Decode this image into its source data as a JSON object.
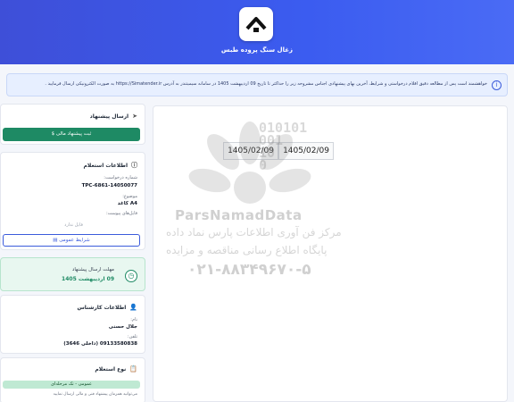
{
  "header": {
    "title": "زغال سنگ پروده طبس"
  },
  "notice": {
    "text": "خواهشمند است پس از مطالعه دقیق اقلام درخواستی و شرایط، آخرین بهای پیشنهادی اجناس مشروحه زیر را حداکثر تا تاریخ 09 اردیبهشت 1405 در سامانه سیمیتندر به آدرس https://Simatender.ir به صورت الکترونیکی ارسال فرمایید ."
  },
  "submit_card": {
    "title": "ارسال پیشنهاد",
    "button": "ثبت پیشنهاد مالی"
  },
  "request_info": {
    "title": "اطلاعات استعلام",
    "number_label": "شماره درخواست:",
    "number_value": "TPC-6861-14050077",
    "subject_label": "موضوع:",
    "subject_value": "کاغذ A4",
    "files_label": "فایل‌های پیوست:",
    "files_none": "فایل ندارد",
    "terms_button": "شرایط عمومی"
  },
  "deadline": {
    "label": "مهلت ارسال پیشنهاد",
    "value": "09 اردیبهشت 1405"
  },
  "expert": {
    "title": "اطلاعات کارشناس",
    "name_label": "نام:",
    "name_value": "جلال حسنی",
    "phone_label": "تلفن:",
    "phone_value": "09133580838 (داخلی 3646)"
  },
  "inquiry_type": {
    "title": "نوع استعلام",
    "badge": "عمومی - تک مرحله‌ای",
    "note": "می‌توانید همزمان پیشنهاد فنی و مالی ارسال نمایید"
  },
  "main": {
    "dates": [
      "1405/02/09",
      "1405/02/09"
    ]
  },
  "watermark": {
    "digits": [
      "010101",
      "001",
      "10",
      "0"
    ],
    "brand": "ParsNamadData",
    "fa_line1": "مرکز فن آوری اطلاعات پارس نماد داده",
    "fa_line2": "پایگاه اطلاع رسانی مناقصه و مزایده",
    "phone": "۰۲۱-۸۸۳۴۹۶۷۰-۵"
  }
}
